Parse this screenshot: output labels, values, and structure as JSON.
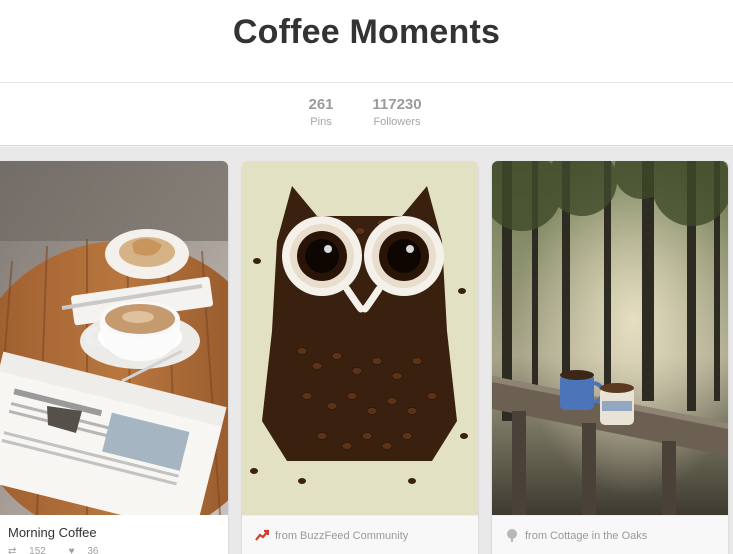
{
  "board": {
    "title": "Coffee Moments"
  },
  "stats": {
    "pins_count": "261",
    "pins_label": "Pins",
    "followers_count": "117230",
    "followers_label": "Followers"
  },
  "pins": [
    {
      "description": "Morning Coffee",
      "repins": "152",
      "likes": "36",
      "repin_icon": "repin-icon",
      "like_icon": "heart-icon"
    },
    {
      "source": "from BuzzFeed Community",
      "source_icon": "trending-icon"
    },
    {
      "source": "from Cottage in the Oaks",
      "source_icon": "tree-icon"
    }
  ],
  "colors": {
    "title": "#333333",
    "stat_text": "#9b9b9b",
    "background": "#e9e9e9",
    "source_icon_red": "#d8392b"
  }
}
